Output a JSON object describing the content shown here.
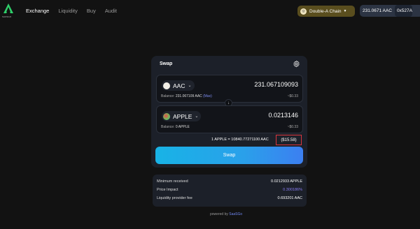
{
  "header": {
    "logo_text": "SAKSGO",
    "nav": [
      "Exchange",
      "Liquidity",
      "Buy",
      "Audit"
    ],
    "chain": "Double-A Chain",
    "account_balance": "231.0671 AAC",
    "account_address": "0x527A"
  },
  "swap": {
    "title": "Swap",
    "from": {
      "symbol": "AAC",
      "amount": "231.067109093",
      "balance_label": "Balance:",
      "balance_value": "231.067109 AAC",
      "max_label": "(Max)",
      "usd": "~$0.33"
    },
    "to": {
      "symbol": "APPLE",
      "amount": "0.0213146",
      "balance_label": "Balance:",
      "balance_value": "0 APPLE",
      "usd": "~$0.33"
    },
    "rate": "1 APPLE = 10840.77271100 AAC",
    "rate_usd": "($15.58)",
    "button_label": "Swap"
  },
  "details": {
    "rows": [
      {
        "label": "Minimum received",
        "value": "0.0212933 APPLE"
      },
      {
        "label": "Price Impact",
        "value": "0.300186%"
      },
      {
        "label": "Liquidity provider fee",
        "value": "0.693201 AAC"
      }
    ]
  },
  "footer": {
    "prefix": "powered by",
    "brand": "SaaSGo"
  },
  "colors": {
    "accent": "#2aa0ea",
    "price_impact": "#8a7ef5",
    "highlight_border": "#d9363e"
  }
}
